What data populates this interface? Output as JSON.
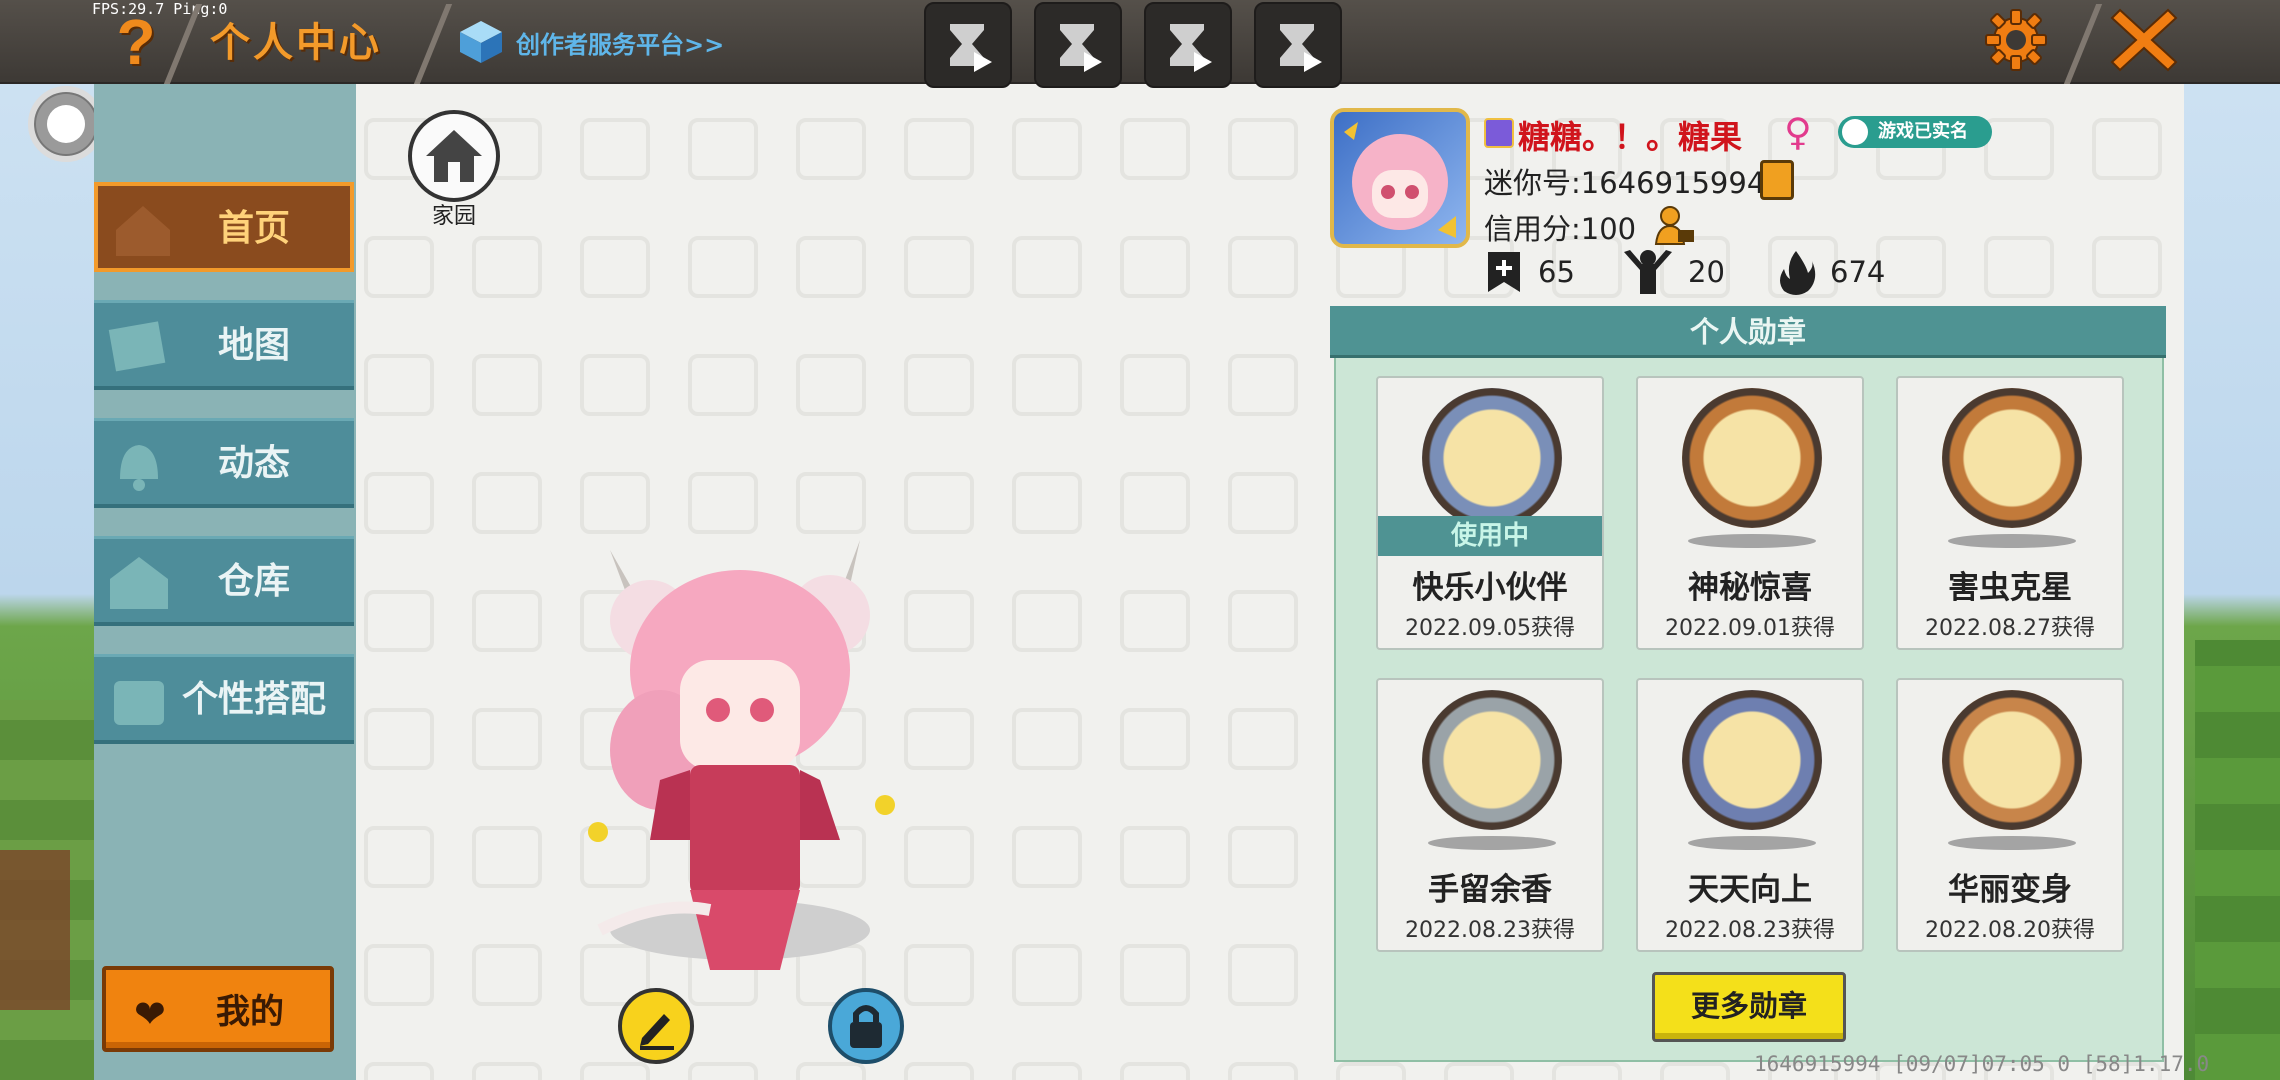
{
  "topbar": {
    "fps_text": "FPS:29.7  Ping:0",
    "help_label": "?",
    "title": "个人中心",
    "creator_link": "创作者服务平台>>"
  },
  "sidebar": {
    "items": [
      {
        "label": "首页",
        "icon": "house-icon",
        "active": true
      },
      {
        "label": "地图",
        "icon": "map-icon",
        "active": false
      },
      {
        "label": "动态",
        "icon": "bell-icon",
        "active": false
      },
      {
        "label": "仓库",
        "icon": "warehouse-icon",
        "active": false
      },
      {
        "label": "个性搭配",
        "icon": "outfit-icon",
        "active": false
      }
    ],
    "mine_label": "我的"
  },
  "home": {
    "label": "家园"
  },
  "profile": {
    "username": "糖糖。！。糖果",
    "gender": "♀",
    "realname_badge": "游戏已实名",
    "mini_id": "迷你号:1646915994",
    "credit": "信用分:100",
    "stats": {
      "add_count": "65",
      "fans_count": "20",
      "fire_count": "674"
    }
  },
  "badges": {
    "title": "个人勋章",
    "in_use_label": "使用中",
    "items": [
      {
        "name": "快乐小伙伴",
        "date": "2022.09.05获得",
        "in_use": true,
        "ring": "#7a8fb8"
      },
      {
        "name": "神秘惊喜",
        "date": "2022.09.01获得",
        "in_use": false,
        "ring": "#c27a3a"
      },
      {
        "name": "害虫克星",
        "date": "2022.08.27获得",
        "in_use": false,
        "ring": "#c27a3a"
      },
      {
        "name": "手留余香",
        "date": "2022.08.23获得",
        "in_use": false,
        "ring": "#9aa3a8"
      },
      {
        "name": "天天向上",
        "date": "2022.08.23获得",
        "in_use": false,
        "ring": "#6e7fb0"
      },
      {
        "name": "华丽变身",
        "date": "2022.08.20获得",
        "in_use": false,
        "ring": "#c8854a"
      }
    ],
    "more_label": "更多勋章"
  },
  "footer": {
    "info": "1646915994   [09/07]07:05 0  [58]1.17.0"
  },
  "colors": {
    "accent_orange": "#f39a2a",
    "teal": "#4f9393",
    "nav": "#4e8d9a"
  }
}
